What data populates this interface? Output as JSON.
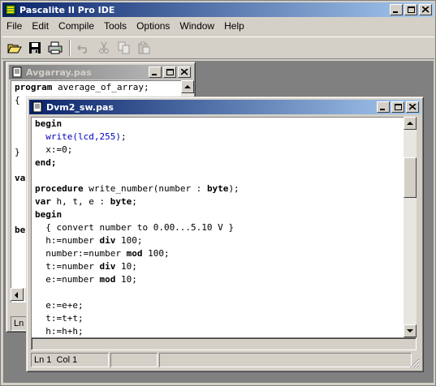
{
  "app": {
    "title": "Pascalite II Pro IDE"
  },
  "menu": [
    "File",
    "Edit",
    "Compile",
    "Tools",
    "Options",
    "Window",
    "Help"
  ],
  "toolbar": {
    "buttons": [
      "open-folder-icon",
      "save-disk-icon",
      "print-icon",
      "undo-icon",
      "cut-icon",
      "copy-icon",
      "paste-icon"
    ]
  },
  "back_window": {
    "title": "Avgarray.pas",
    "visible_lines": [
      [
        [
          "kw",
          "program"
        ],
        [
          "",
          " average_of_array;"
        ]
      ],
      [
        [
          "",
          "{"
        ]
      ],
      [
        [
          "",
          ""
        ]
      ],
      [
        [
          "",
          ""
        ]
      ],
      [
        [
          "",
          ""
        ]
      ],
      [
        [
          "",
          "}"
        ]
      ],
      [
        [
          "",
          ""
        ]
      ],
      [
        [
          "kw",
          "va"
        ]
      ],
      [
        [
          "",
          ""
        ]
      ],
      [
        [
          "",
          ""
        ]
      ],
      [
        [
          "",
          ""
        ]
      ],
      [
        [
          "kw",
          "be"
        ]
      ]
    ],
    "status_ln": "Ln 1"
  },
  "front_window": {
    "title": "Dvm2_sw.pas",
    "lines": [
      [
        [
          "kw",
          "begin"
        ]
      ],
      [
        [
          "",
          "  "
        ],
        [
          "fn",
          "write"
        ],
        [
          "fn",
          "(lcd,255)"
        ],
        [
          "",
          ";"
        ]
      ],
      [
        [
          "",
          "  x:=0;"
        ]
      ],
      [
        [
          "kw",
          "end;"
        ]
      ],
      [
        [
          "",
          ""
        ]
      ],
      [
        [
          "kw",
          "procedure"
        ],
        [
          "",
          " write_number(number : "
        ],
        [
          "kw",
          "byte"
        ],
        [
          "",
          ");"
        ]
      ],
      [
        [
          "kw",
          "var"
        ],
        [
          "",
          " h, t, e : "
        ],
        [
          "kw",
          "byte"
        ],
        [
          "",
          ";"
        ]
      ],
      [
        [
          "kw",
          "begin"
        ]
      ],
      [
        [
          "",
          "  { convert number to 0.00...5.10 V }"
        ]
      ],
      [
        [
          "",
          "  h:=number "
        ],
        [
          "kw",
          "div"
        ],
        [
          "",
          " 100;"
        ]
      ],
      [
        [
          "",
          "  number:=number "
        ],
        [
          "kw",
          "mod"
        ],
        [
          "",
          " 100;"
        ]
      ],
      [
        [
          "",
          "  t:=number "
        ],
        [
          "kw",
          "div"
        ],
        [
          "",
          " 10;"
        ]
      ],
      [
        [
          "",
          "  e:=number "
        ],
        [
          "kw",
          "mod"
        ],
        [
          "",
          " 10;"
        ]
      ],
      [
        [
          "",
          ""
        ]
      ],
      [
        [
          "",
          "  e:=e+e;"
        ]
      ],
      [
        [
          "",
          "  t:=t+t;"
        ]
      ],
      [
        [
          "",
          "  h:=h+h;"
        ]
      ]
    ],
    "status": {
      "ln": "Ln 1",
      "col": "Col 1",
      "cell2": "",
      "cell3": ""
    }
  },
  "colors": {
    "title_active": "#0a246a",
    "title_inactive": "#808080",
    "keyword_fn": "#0000c0"
  }
}
